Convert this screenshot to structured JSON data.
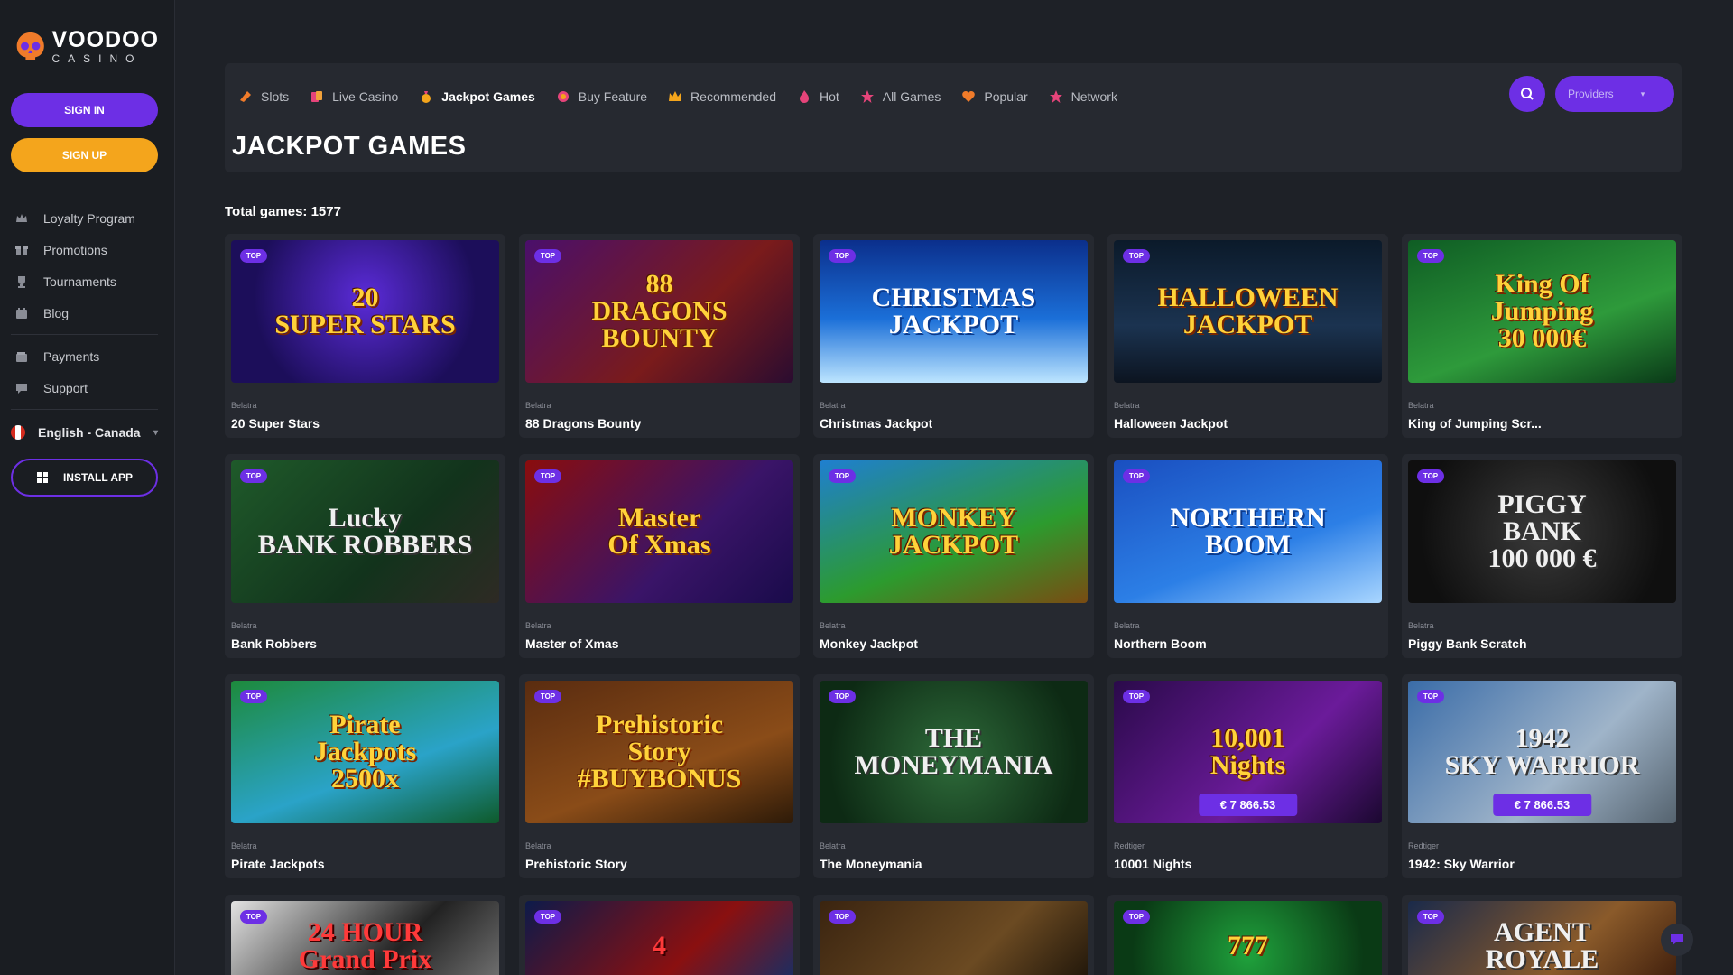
{
  "brand": {
    "name": "VOODOO",
    "sub": "CASINO",
    "accent": "#6d2fe5",
    "secondary": "#f4a51c"
  },
  "sidebar": {
    "sign_in": "SIGN IN",
    "sign_up": "SIGN UP",
    "menu1": [
      {
        "label": "Loyalty Program",
        "icon": "crown-icon"
      },
      {
        "label": "Promotions",
        "icon": "gift-icon"
      },
      {
        "label": "Tournaments",
        "icon": "trophy-icon"
      },
      {
        "label": "Blog",
        "icon": "blog-icon"
      }
    ],
    "menu2": [
      {
        "label": "Payments",
        "icon": "wallet-icon"
      },
      {
        "label": "Support",
        "icon": "chat-icon"
      }
    ],
    "language": "English - Canada",
    "install": "INSTALL APP"
  },
  "tabs": [
    {
      "label": "Slots",
      "icon": "slots-icon"
    },
    {
      "label": "Live Casino",
      "icon": "cards-icon"
    },
    {
      "label": "Jackpot Games",
      "icon": "moneybag-icon"
    },
    {
      "label": "Buy Feature",
      "icon": "coin-icon"
    },
    {
      "label": "Recommended",
      "icon": "crown-icon"
    },
    {
      "label": "Hot",
      "icon": "fire-icon"
    },
    {
      "label": "All Games",
      "icon": "star-icon"
    },
    {
      "label": "Popular",
      "icon": "heart-icon"
    },
    {
      "label": "Network",
      "icon": "star-icon"
    }
  ],
  "active_tab": "Jackpot Games",
  "page_title": "JACKPOT GAMES",
  "providers_label": "Providers",
  "total_games": "Total games: 1577",
  "badge": "TOP",
  "games": [
    {
      "provider": "Belatra",
      "name": "20 Super Stars",
      "art": "20\nSUPER STARS"
    },
    {
      "provider": "Belatra",
      "name": "88 Dragons Bounty",
      "art": "88\nDRAGONS\nBOUNTY"
    },
    {
      "provider": "Belatra",
      "name": "Christmas Jackpot",
      "art": "CHRISTMAS\nJACKPOT"
    },
    {
      "provider": "Belatra",
      "name": "Halloween Jackpot",
      "art": "HALLOWEEN\nJACKPOT"
    },
    {
      "provider": "Belatra",
      "name": "King of Jumping Scr...",
      "art": "King Of\nJumping\n30 000€"
    },
    {
      "provider": "Belatra",
      "name": "Bank Robbers",
      "art": "Lucky\nBANK ROBBERS"
    },
    {
      "provider": "Belatra",
      "name": "Master of Xmas",
      "art": "Master\nOf Xmas"
    },
    {
      "provider": "Belatra",
      "name": "Monkey Jackpot",
      "art": "MONKEY\nJACKPOT"
    },
    {
      "provider": "Belatra",
      "name": "Northern Boom",
      "art": "NORTHERN\nBOOM"
    },
    {
      "provider": "Belatra",
      "name": "Piggy Bank Scratch",
      "art": "PIGGY\nBANK\n100 000 €"
    },
    {
      "provider": "Belatra",
      "name": "Pirate Jackpots",
      "art": "Pirate\nJackpots\n2500x"
    },
    {
      "provider": "Belatra",
      "name": "Prehistoric Story",
      "art": "Prehistoric\nStory\n#BUYBONUS"
    },
    {
      "provider": "Belatra",
      "name": "The Moneymania",
      "art": "THE\nMONEYMANIA"
    },
    {
      "provider": "Redtiger",
      "name": "10001 Nights",
      "art": "10,001\nNights",
      "jackpot": "€ 7 866.53"
    },
    {
      "provider": "Redtiger",
      "name": "1942: Sky Warrior",
      "art": "1942\nSKY WARRIOR",
      "jackpot": "€ 7 866.53"
    },
    {
      "provider": "",
      "name": "",
      "art": "24 HOUR\nGrand Prix"
    },
    {
      "provider": "",
      "name": "",
      "art": "4"
    },
    {
      "provider": "",
      "name": "",
      "art": ""
    },
    {
      "provider": "",
      "name": "",
      "art": "777"
    },
    {
      "provider": "",
      "name": "",
      "art": "AGENT\nROYALE"
    }
  ]
}
